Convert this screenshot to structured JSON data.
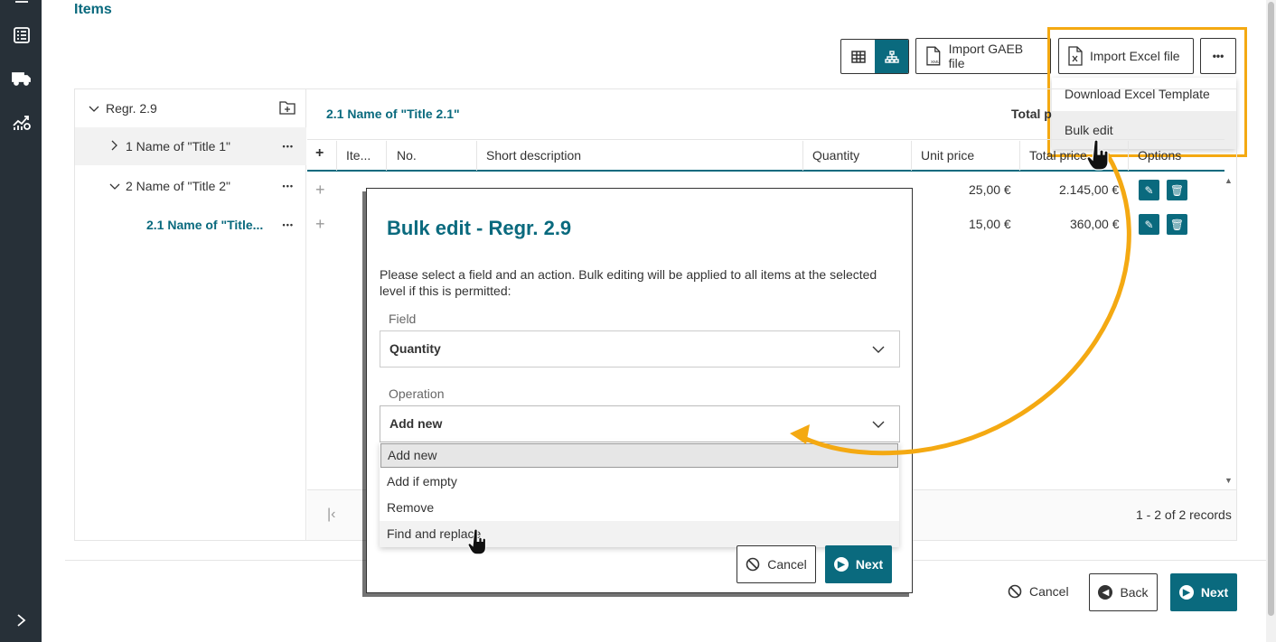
{
  "page": {
    "section_title": "Items"
  },
  "toolbar": {
    "import_gaeb": "Import GAEB file",
    "import_excel": "Import Excel file",
    "more": "•••"
  },
  "more_menu": {
    "items": [
      "Download Excel Template",
      "Bulk edit"
    ]
  },
  "tree": {
    "items": [
      {
        "label": "Regr. 2.9",
        "expanded": true
      },
      {
        "label": "1 Name of \"Title 1\"",
        "expanded": false
      },
      {
        "label": "2 Name of \"Title 2\"",
        "expanded": true
      },
      {
        "label": "2.1 Name of \"Title..."
      }
    ],
    "more": "•••"
  },
  "grid": {
    "title": "2.1 Name of \"Title 2.1\"",
    "total_label": "Total p",
    "columns": [
      "+",
      "Ite...",
      "No.",
      "Short description",
      "Quantity",
      "Unit price",
      "Total price",
      "Options"
    ],
    "rows": [
      {
        "unit_price": "25,00 €",
        "total_price": "2.145,00 €"
      },
      {
        "unit_price": "15,00 €",
        "total_price": "360,00 €"
      }
    ],
    "records": "1 - 2 of 2 records"
  },
  "footer": {
    "cancel": "Cancel",
    "back": "Back",
    "next": "Next"
  },
  "modal": {
    "title": "Bulk edit - Regr. 2.9",
    "description": "Please select a field and an action. Bulk editing will be applied to all items at the selected level if this is permitted:",
    "field_label": "Field",
    "field_value": "Quantity",
    "operation_label": "Operation",
    "operation_value": "Add new",
    "operation_options": [
      "Add new",
      "Add if empty",
      "Remove",
      "Find and replace"
    ],
    "cancel": "Cancel",
    "next": "Next"
  },
  "colors": {
    "primary": "#0a6a7e",
    "sidebar": "#273038",
    "highlight": "#f4a912"
  }
}
